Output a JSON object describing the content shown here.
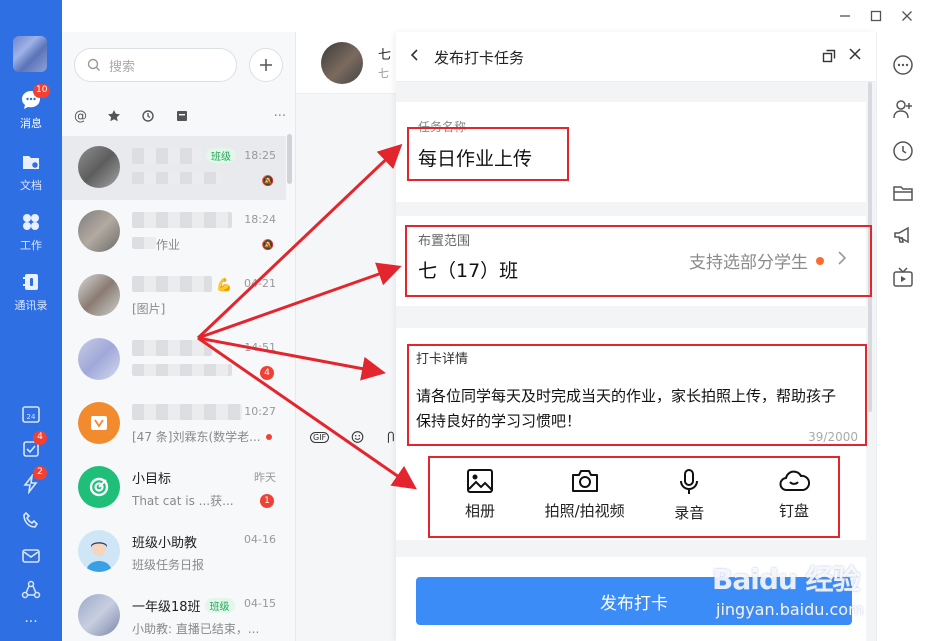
{
  "nav": {
    "items": [
      {
        "label": "消息",
        "badge": "10"
      },
      {
        "label": "文档"
      },
      {
        "label": "工作"
      },
      {
        "label": "通讯录"
      }
    ],
    "bottom_badges": {
      "tasks": "4",
      "flash": "2"
    },
    "more": "···"
  },
  "search": {
    "placeholder": "搜索"
  },
  "conversations": [
    {
      "name": "",
      "tag": "班级",
      "time": "18:25",
      "snippet": ""
    },
    {
      "name": "",
      "tag": "",
      "time": "18:24",
      "snippet": "作业"
    },
    {
      "name": "",
      "tag": "",
      "time": "04-21",
      "snippet": "[图片]"
    },
    {
      "name": "",
      "tag": "",
      "time": "14:51",
      "snippet": "",
      "badge": "4"
    },
    {
      "name": "",
      "tag": "",
      "time": "10:27",
      "snippet": "[47 条]刘霖东(数学老..."
    },
    {
      "name": "小目标",
      "tag": "",
      "time": "昨天",
      "snippet": "That cat is ...获...",
      "badge": "1"
    },
    {
      "name": "班级小助教",
      "tag": "",
      "time": "04-16",
      "snippet": "班级任务日报"
    },
    {
      "name": "一年级18班",
      "tag": "班级",
      "time": "04-15",
      "snippet": "小助教: 直播已结束，..."
    }
  ],
  "chat": {
    "title": "七",
    "subtitle": "七",
    "gif": "GIF"
  },
  "panel": {
    "title": "发布打卡任务",
    "task_name_label": "任务名称",
    "task_name": "每日作业上传",
    "scope_label": "布置范围",
    "scope_value": "七（17）班",
    "scope_hint": "支持选部分学生",
    "detail_label": "打卡详情",
    "detail_text": "请各位同学每天及时完成当天的作业，家长拍照上传，帮助孩子保持良好的学习习惯吧！",
    "counter": "39/2000",
    "tools": [
      {
        "label": "相册",
        "icon": "image-icon"
      },
      {
        "label": "拍照/拍视频",
        "icon": "camera-icon"
      },
      {
        "label": "录音",
        "icon": "microphone-icon"
      },
      {
        "label": "钉盘",
        "icon": "cloud-icon"
      }
    ],
    "publish": "发布打卡"
  },
  "watermark": {
    "brand": "Baidu 经验",
    "url": "jingyan.baidu.com"
  },
  "colors": {
    "nav": "#2f6fe4",
    "primary": "#3b8cf6",
    "annotation": "#e3262e",
    "badge": "#f04134"
  }
}
